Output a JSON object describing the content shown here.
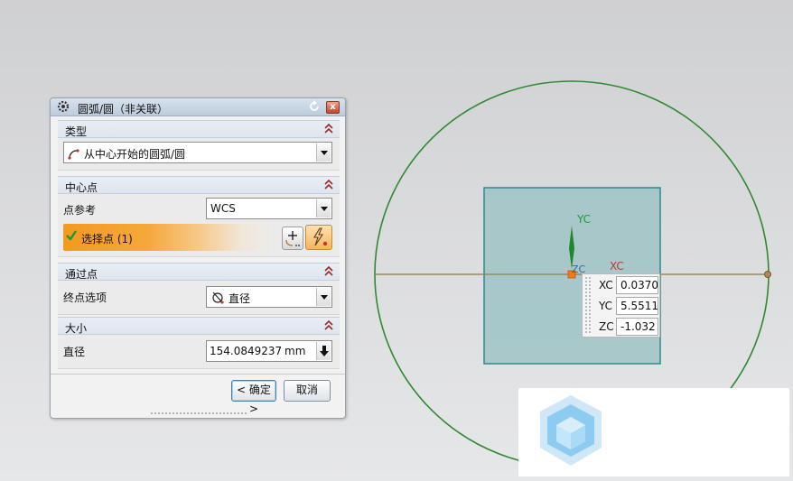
{
  "dialog": {
    "title": "圆弧/圆（非关联）",
    "close_label": "x",
    "sections": {
      "type": {
        "header": "类型",
        "combo_value": "从中心开始的圆弧/圆"
      },
      "center": {
        "header": "中心点",
        "ref_label": "点参考",
        "ref_value": "WCS",
        "select_label": "选择点 (1)"
      },
      "through": {
        "header": "通过点",
        "end_option_label": "终点选项",
        "end_option_value": "直径"
      },
      "size": {
        "header": "大小",
        "diameter_label": "直径",
        "diameter_value": "154.0849237",
        "unit": "mm"
      }
    },
    "buttons": {
      "ok": "< 确定 >",
      "cancel": "取消"
    }
  },
  "viewport": {
    "axis_y_label": "YC",
    "axis_x_label": "XC",
    "axis_z_label": "ZC",
    "coords": [
      {
        "label": "XC",
        "value": "0.0370"
      },
      {
        "label": "YC",
        "value": "5.5511"
      },
      {
        "label": "ZC",
        "value": "-1.032"
      }
    ]
  },
  "colors": {
    "circle": "#2f8a2f",
    "plane": "#9ec3c6",
    "plane_border": "#2d8a8a",
    "line": "#9a8a55",
    "accent_orange": "#f39a1f"
  }
}
